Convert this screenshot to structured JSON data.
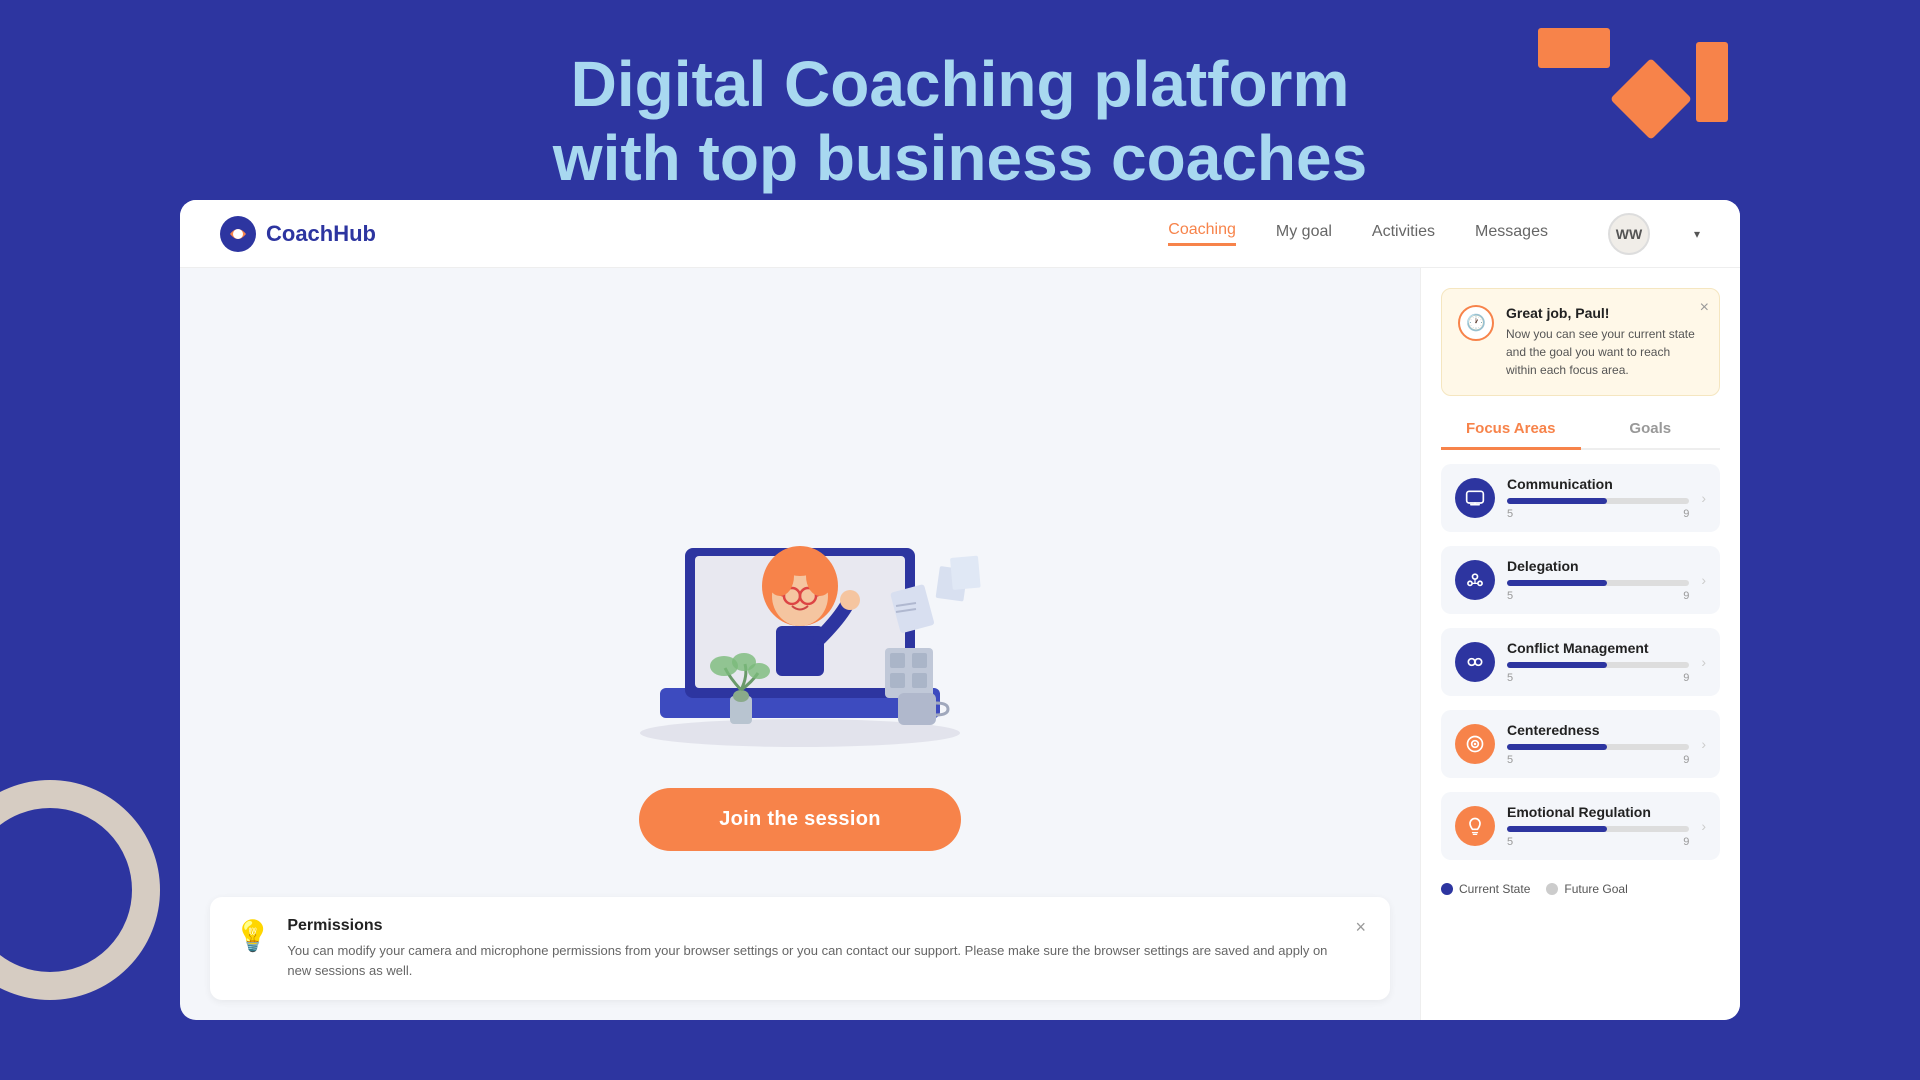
{
  "page": {
    "title_line1": "Digital Coaching platform",
    "title_line2": "with top business coaches"
  },
  "navbar": {
    "logo_text": "CoachHub",
    "nav_items": [
      {
        "label": "Coaching",
        "active": true
      },
      {
        "label": "My goal",
        "active": false
      },
      {
        "label": "Activities",
        "active": false
      },
      {
        "label": "Messages",
        "active": false
      }
    ],
    "avatar_initials": "WW"
  },
  "notification": {
    "title": "Great job, Paul!",
    "text": "Now you can see your current state and the goal you want to reach within each focus area.",
    "close_label": "×"
  },
  "tabs": [
    {
      "label": "Focus Areas",
      "active": true
    },
    {
      "label": "Goals",
      "active": false
    }
  ],
  "focus_areas": [
    {
      "name": "Communication",
      "current": 5,
      "goal": 9,
      "progress_pct": 55,
      "icon": "💬",
      "icon_type": "purple"
    },
    {
      "name": "Delegation",
      "current": 5,
      "goal": 9,
      "progress_pct": 55,
      "icon": "🔄",
      "icon_type": "purple"
    },
    {
      "name": "Conflict Management",
      "current": 5,
      "goal": 9,
      "progress_pct": 55,
      "icon": "🤝",
      "icon_type": "purple"
    },
    {
      "name": "Centeredness",
      "current": 5,
      "goal": 9,
      "progress_pct": 55,
      "icon": "🎯",
      "icon_type": "orange"
    },
    {
      "name": "Emotional Regulation",
      "current": 5,
      "goal": 9,
      "progress_pct": 55,
      "icon": "🧠",
      "icon_type": "orange"
    }
  ],
  "legend": {
    "current_state_label": "Current State",
    "future_goal_label": "Future Goal"
  },
  "join_button_label": "Join the session",
  "permissions": {
    "title": "Permissions",
    "text": "You can modify your camera and microphone permissions from your browser settings or you can contact our support. Please make sure the browser settings are saved and apply on new sessions as well.",
    "close_label": "×"
  }
}
